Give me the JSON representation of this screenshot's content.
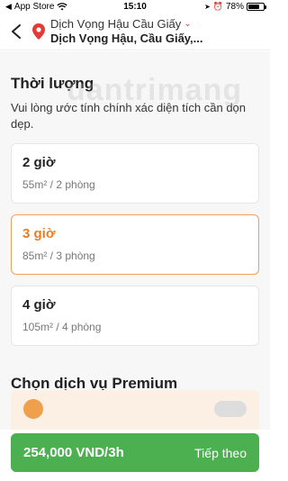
{
  "status_bar": {
    "carrier": "App Store",
    "time": "15:10",
    "battery_text": "78%",
    "battery_level": 0.78
  },
  "header": {
    "back_icon": "back-arrow-icon",
    "location_icon": "map-pin-icon",
    "address_line1": "Dịch Vọng Hậu Cầu Giấy",
    "address_line2": "Dịch Vọng Hậu, Cầu Giấy,..."
  },
  "duration": {
    "title": "Thời lượng",
    "description": "Vui lòng ước tính chính xác diện tích cần dọn dẹp.",
    "options": [
      {
        "hours": "2 giờ",
        "detail": "55m² / 2 phòng",
        "selected": false
      },
      {
        "hours": "3 giờ",
        "detail": "85m² / 3 phòng",
        "selected": true
      },
      {
        "hours": "4 giờ",
        "detail": "105m² / 4 phòng",
        "selected": false
      }
    ]
  },
  "watermark": "uantrimang",
  "premium": {
    "title": "Chọn dịch vụ Premium"
  },
  "footer": {
    "price": "254,000 VND/3h",
    "next_label": "Tiếp theo"
  },
  "colors": {
    "accent_orange": "#e67e22",
    "cta_green": "#4caf50",
    "pin_red": "#e53935"
  }
}
